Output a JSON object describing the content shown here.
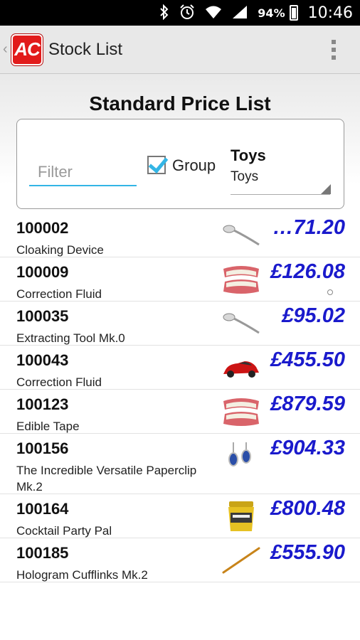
{
  "status_bar": {
    "battery_percent": "94%",
    "clock": "10:46",
    "icons": [
      "bluetooth-icon",
      "alarm-icon",
      "wifi-icon",
      "signal-icon",
      "battery-icon"
    ]
  },
  "action_bar": {
    "logo_text": "AC",
    "title": "Stock List"
  },
  "heading": "Standard Price List",
  "filter": {
    "placeholder": "Filter",
    "value": "",
    "group_label": "Group",
    "group_checked": true,
    "category_title": "Toys",
    "category_selected": "Toys"
  },
  "colors": {
    "price": "#1a1acc",
    "accent": "#33b5e5",
    "logo": "#e21b1b"
  },
  "items": [
    {
      "code": "100002",
      "name": "Cloaking Device",
      "price": "…71.20",
      "thumb": "spoon"
    },
    {
      "code": "100009",
      "name": "Correction Fluid",
      "price": "£126.08",
      "thumb": "dentures"
    },
    {
      "code": "100035",
      "name": "Extracting Tool Mk.0",
      "price": "£95.02",
      "thumb": "spoon"
    },
    {
      "code": "100043",
      "name": "Correction Fluid",
      "price": "£455.50",
      "thumb": "car"
    },
    {
      "code": "100123",
      "name": "Edible Tape",
      "price": "£879.59",
      "thumb": "dentures"
    },
    {
      "code": "100156",
      "name": "The Incredible Versatile Paperclip Mk.2",
      "price": "£904.33",
      "thumb": "earrings"
    },
    {
      "code": "100164",
      "name": "Cocktail Party Pal",
      "price": "£800.48",
      "thumb": "tub"
    },
    {
      "code": "100185",
      "name": "Hologram Cufflinks Mk.2",
      "price": "£555.90",
      "thumb": "stick"
    }
  ]
}
